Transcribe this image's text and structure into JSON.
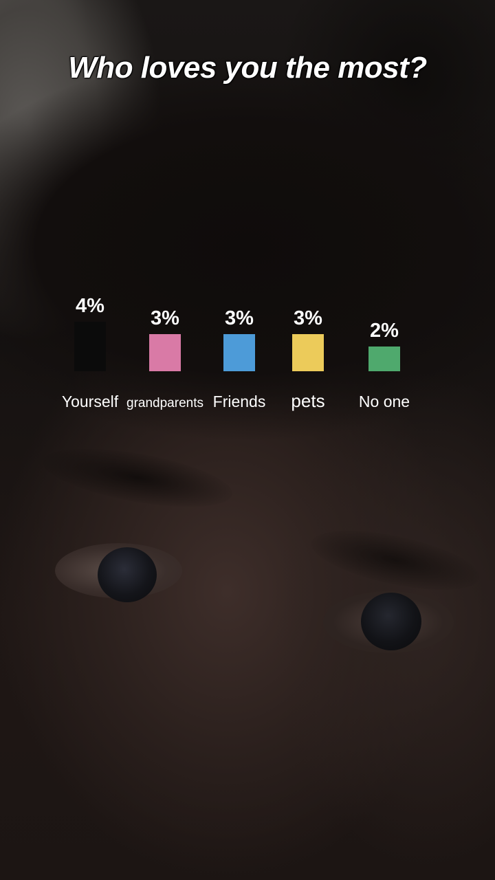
{
  "title": "Who loves you the most?",
  "colors": {
    "Yourself": "#0b0b0b",
    "grandparents": "#d97aa6",
    "Friends": "#4d9bd8",
    "pets": "#eccb5a",
    "No one": "#4fa96d"
  },
  "chart_data": {
    "type": "bar",
    "title": "Who loves you the most?",
    "categories": [
      "Yourself",
      "grandparents",
      "Friends",
      "pets",
      "No one"
    ],
    "values": [
      4,
      3,
      3,
      3,
      2
    ],
    "value_labels": [
      "4%",
      "3%",
      "3%",
      "3%",
      "2%"
    ],
    "value_unit": "%",
    "bar_colors": [
      "#0b0b0b",
      "#d97aa6",
      "#4d9bd8",
      "#eccb5a",
      "#4fa96d"
    ],
    "xlabel": "",
    "ylabel": "",
    "grid": false,
    "legend": "none"
  }
}
